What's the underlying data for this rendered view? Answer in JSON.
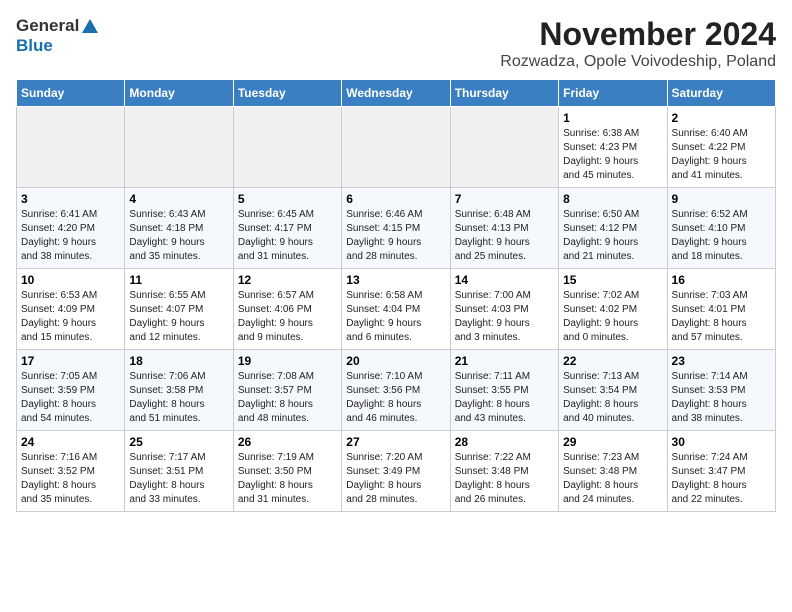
{
  "header": {
    "logo_general": "General",
    "logo_blue": "Blue",
    "title": "November 2024",
    "subtitle": "Rozwadza, Opole Voivodeship, Poland"
  },
  "weekdays": [
    "Sunday",
    "Monday",
    "Tuesday",
    "Wednesday",
    "Thursday",
    "Friday",
    "Saturday"
  ],
  "weeks": [
    [
      {
        "day": "",
        "info": ""
      },
      {
        "day": "",
        "info": ""
      },
      {
        "day": "",
        "info": ""
      },
      {
        "day": "",
        "info": ""
      },
      {
        "day": "",
        "info": ""
      },
      {
        "day": "1",
        "info": "Sunrise: 6:38 AM\nSunset: 4:23 PM\nDaylight: 9 hours\nand 45 minutes."
      },
      {
        "day": "2",
        "info": "Sunrise: 6:40 AM\nSunset: 4:22 PM\nDaylight: 9 hours\nand 41 minutes."
      }
    ],
    [
      {
        "day": "3",
        "info": "Sunrise: 6:41 AM\nSunset: 4:20 PM\nDaylight: 9 hours\nand 38 minutes."
      },
      {
        "day": "4",
        "info": "Sunrise: 6:43 AM\nSunset: 4:18 PM\nDaylight: 9 hours\nand 35 minutes."
      },
      {
        "day": "5",
        "info": "Sunrise: 6:45 AM\nSunset: 4:17 PM\nDaylight: 9 hours\nand 31 minutes."
      },
      {
        "day": "6",
        "info": "Sunrise: 6:46 AM\nSunset: 4:15 PM\nDaylight: 9 hours\nand 28 minutes."
      },
      {
        "day": "7",
        "info": "Sunrise: 6:48 AM\nSunset: 4:13 PM\nDaylight: 9 hours\nand 25 minutes."
      },
      {
        "day": "8",
        "info": "Sunrise: 6:50 AM\nSunset: 4:12 PM\nDaylight: 9 hours\nand 21 minutes."
      },
      {
        "day": "9",
        "info": "Sunrise: 6:52 AM\nSunset: 4:10 PM\nDaylight: 9 hours\nand 18 minutes."
      }
    ],
    [
      {
        "day": "10",
        "info": "Sunrise: 6:53 AM\nSunset: 4:09 PM\nDaylight: 9 hours\nand 15 minutes."
      },
      {
        "day": "11",
        "info": "Sunrise: 6:55 AM\nSunset: 4:07 PM\nDaylight: 9 hours\nand 12 minutes."
      },
      {
        "day": "12",
        "info": "Sunrise: 6:57 AM\nSunset: 4:06 PM\nDaylight: 9 hours\nand 9 minutes."
      },
      {
        "day": "13",
        "info": "Sunrise: 6:58 AM\nSunset: 4:04 PM\nDaylight: 9 hours\nand 6 minutes."
      },
      {
        "day": "14",
        "info": "Sunrise: 7:00 AM\nSunset: 4:03 PM\nDaylight: 9 hours\nand 3 minutes."
      },
      {
        "day": "15",
        "info": "Sunrise: 7:02 AM\nSunset: 4:02 PM\nDaylight: 9 hours\nand 0 minutes."
      },
      {
        "day": "16",
        "info": "Sunrise: 7:03 AM\nSunset: 4:01 PM\nDaylight: 8 hours\nand 57 minutes."
      }
    ],
    [
      {
        "day": "17",
        "info": "Sunrise: 7:05 AM\nSunset: 3:59 PM\nDaylight: 8 hours\nand 54 minutes."
      },
      {
        "day": "18",
        "info": "Sunrise: 7:06 AM\nSunset: 3:58 PM\nDaylight: 8 hours\nand 51 minutes."
      },
      {
        "day": "19",
        "info": "Sunrise: 7:08 AM\nSunset: 3:57 PM\nDaylight: 8 hours\nand 48 minutes."
      },
      {
        "day": "20",
        "info": "Sunrise: 7:10 AM\nSunset: 3:56 PM\nDaylight: 8 hours\nand 46 minutes."
      },
      {
        "day": "21",
        "info": "Sunrise: 7:11 AM\nSunset: 3:55 PM\nDaylight: 8 hours\nand 43 minutes."
      },
      {
        "day": "22",
        "info": "Sunrise: 7:13 AM\nSunset: 3:54 PM\nDaylight: 8 hours\nand 40 minutes."
      },
      {
        "day": "23",
        "info": "Sunrise: 7:14 AM\nSunset: 3:53 PM\nDaylight: 8 hours\nand 38 minutes."
      }
    ],
    [
      {
        "day": "24",
        "info": "Sunrise: 7:16 AM\nSunset: 3:52 PM\nDaylight: 8 hours\nand 35 minutes."
      },
      {
        "day": "25",
        "info": "Sunrise: 7:17 AM\nSunset: 3:51 PM\nDaylight: 8 hours\nand 33 minutes."
      },
      {
        "day": "26",
        "info": "Sunrise: 7:19 AM\nSunset: 3:50 PM\nDaylight: 8 hours\nand 31 minutes."
      },
      {
        "day": "27",
        "info": "Sunrise: 7:20 AM\nSunset: 3:49 PM\nDaylight: 8 hours\nand 28 minutes."
      },
      {
        "day": "28",
        "info": "Sunrise: 7:22 AM\nSunset: 3:48 PM\nDaylight: 8 hours\nand 26 minutes."
      },
      {
        "day": "29",
        "info": "Sunrise: 7:23 AM\nSunset: 3:48 PM\nDaylight: 8 hours\nand 24 minutes."
      },
      {
        "day": "30",
        "info": "Sunrise: 7:24 AM\nSunset: 3:47 PM\nDaylight: 8 hours\nand 22 minutes."
      }
    ]
  ]
}
